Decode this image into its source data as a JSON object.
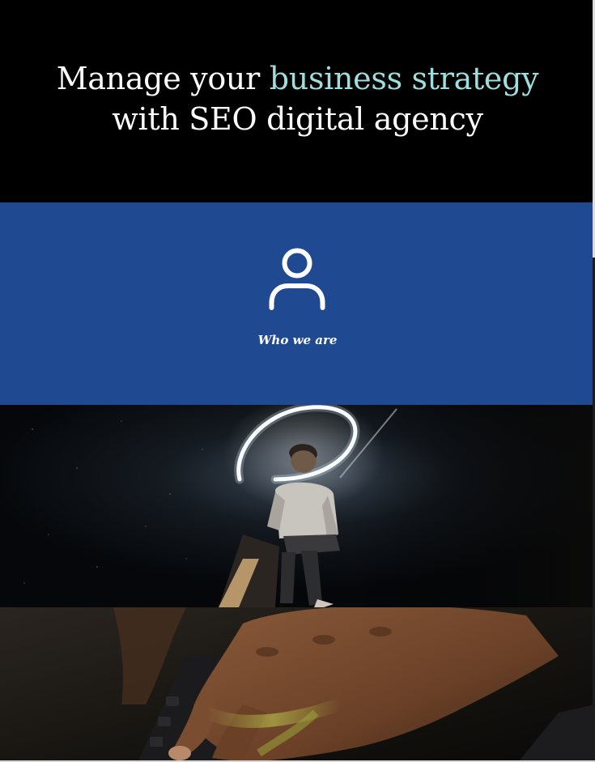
{
  "hero": {
    "title_part1": "Manage your ",
    "title_accent": "business strategy",
    "title_part2": "with SEO digital agency",
    "accent_color": "#9fdede",
    "background": "#000000"
  },
  "who_section": {
    "icon": "user-icon",
    "label": "Who we are",
    "background": "#1f4a91"
  },
  "images": [
    {
      "name": "man-with-light-ring-photo"
    },
    {
      "name": "hands-on-keyboard-photo"
    }
  ]
}
